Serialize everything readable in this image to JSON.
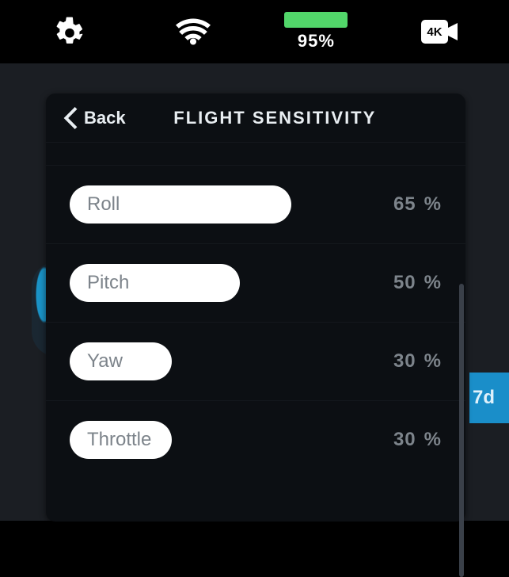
{
  "status": {
    "battery_pct": "95%"
  },
  "background": {
    "right_label": "7d"
  },
  "panel": {
    "back_label": "Back",
    "title": "FLIGHT SENSITIVITY"
  },
  "sliders": [
    {
      "name": "Roll",
      "value": 65,
      "display": "65",
      "unit": "%"
    },
    {
      "name": "Pitch",
      "value": 50,
      "display": "50",
      "unit": "%"
    },
    {
      "name": "Yaw",
      "value": 30,
      "display": "30",
      "unit": "%"
    },
    {
      "name": "Throttle",
      "value": 30,
      "display": "30",
      "unit": "%"
    }
  ]
}
